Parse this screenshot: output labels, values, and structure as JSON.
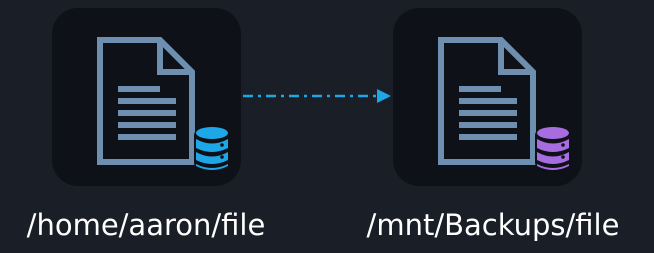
{
  "source": {
    "path": "/home/aaron/file",
    "file_icon": "document-icon",
    "storage_icon": "database-icon",
    "storage_color": "#1ea7e6"
  },
  "destination": {
    "path": "/mnt/Backups/file",
    "file_icon": "document-icon",
    "storage_icon": "database-icon",
    "storage_color": "#a76de0"
  },
  "connector": {
    "style": "dash-dot",
    "direction": "source-to-destination",
    "color": "#1ea7e6"
  },
  "colors": {
    "background": "#1a1e27",
    "tile": "#0e1117",
    "document": "#6e8fb0",
    "text": "#ffffff"
  }
}
